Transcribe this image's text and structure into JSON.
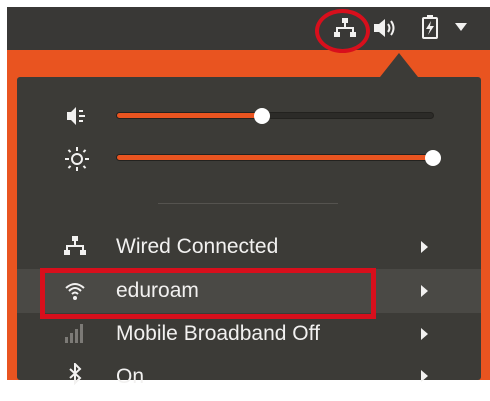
{
  "panel": {
    "icons": [
      "network-wired-icon",
      "volume-icon",
      "battery-charging-icon",
      "menu-arrow-icon"
    ]
  },
  "sliders": {
    "volume": {
      "icon": "volume-icon",
      "level": 0.46
    },
    "brightness": {
      "icon": "brightness-icon",
      "level": 1.0
    }
  },
  "menu": {
    "items": [
      {
        "label": "Wired Connected",
        "icon": "network-wired-icon"
      },
      {
        "label": "eduroam",
        "icon": "wifi-icon"
      },
      {
        "label": "Mobile Broadband Off",
        "icon": "signal-bars-icon"
      },
      {
        "label": "On",
        "icon": "bluetooth-icon"
      }
    ]
  },
  "colors": {
    "accent": "#e95420",
    "panel_bg": "#393836",
    "menu_bg": "#3c3b37",
    "highlight_annotation": "#d80f1c"
  }
}
